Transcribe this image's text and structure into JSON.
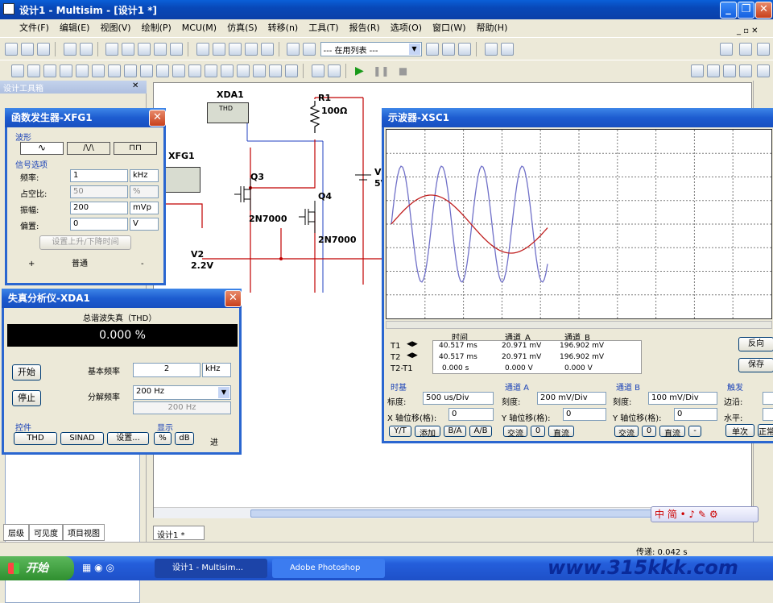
{
  "app": {
    "title": "设计1 - Multisim - [设计1 *]",
    "menu": [
      "文件(F)",
      "编辑(E)",
      "视图(V)",
      "绘制(P)",
      "MCU(M)",
      "仿真(S)",
      "转移(n)",
      "工具(T)",
      "报告(R)",
      "选项(O)",
      "窗口(W)",
      "帮助(H)"
    ],
    "in_use_list": "--- 在用列表 ---"
  },
  "design_toolbox": {
    "title": "设计工具箱",
    "tabs": [
      "层级",
      "可见度",
      "项目视图"
    ]
  },
  "function_generator": {
    "title": "函数发生器-XFG1",
    "waveform_label": "波形",
    "signal_options_label": "信号选项",
    "rows": [
      {
        "label": "频率:",
        "value": "1",
        "unit": "kHz"
      },
      {
        "label": "占空比:",
        "value": "50",
        "unit": "%"
      },
      {
        "label": "振幅:",
        "value": "200",
        "unit": "mVp"
      },
      {
        "label": "偏置:",
        "value": "0",
        "unit": "V"
      }
    ],
    "rise_fall_button": "设置上升/下降时间",
    "plus": "+",
    "common": "普通",
    "minus": "-"
  },
  "distortion_analyzer": {
    "title": "失真分析仪-XDA1",
    "thd_label": "总谐波失真（THD）",
    "thd_value": "0.000 %",
    "start_button": "开始",
    "stop_button": "停止",
    "fundamental_label": "基本频率",
    "fundamental_value": "2",
    "fundamental_unit": "kHz",
    "resolution_label": "分解频率",
    "resolution_value": "200 Hz",
    "resolution_readout": "200 Hz",
    "controls_label": "控件",
    "display_label": "显示",
    "thd_button": "THD",
    "sinad_button": "SINAD",
    "settings_button": "设置...",
    "percent_button": "%",
    "db_button": "dB",
    "in_label": "进"
  },
  "schematic": {
    "xda1": "XDA1",
    "thd_box": "THD",
    "xfg1": "XFG1",
    "r1": "R1",
    "r1_value": "100Ω",
    "q3": "Q3",
    "q3_part": "2N7000",
    "q4": "Q4",
    "q4_part": "2N7000",
    "v2": "V2",
    "v2_value": "2.2V",
    "v1": "V",
    "v1_value": "5V",
    "tab_label": "设计1 *"
  },
  "oscilloscope": {
    "title": "示波器-XSC1",
    "readout_headers": [
      "时间",
      "通道_A",
      "通道_B"
    ],
    "readout_rows": [
      {
        "label": "T1",
        "time": "40.517 ms",
        "a": "20.971 mV",
        "b": "196.902 mV"
      },
      {
        "label": "T2",
        "time": "40.517 ms",
        "a": "20.971 mV",
        "b": "196.902 mV"
      },
      {
        "label": "T2-T1",
        "time": "0.000 s",
        "a": "0.000 V",
        "b": "0.000 V"
      }
    ],
    "reverse_button": "反向",
    "save_button": "保存",
    "timebase": {
      "title": "时基",
      "scale_label": "标度:",
      "scale": "500 us/Div",
      "xpos_label": "X 轴位移(格):",
      "xpos": "0",
      "buttons": [
        "Y/T",
        "添加",
        "B/A",
        "A/B"
      ]
    },
    "channel_a": {
      "title": "通道 A",
      "scale_label": "刻度:",
      "scale": "200 mV/Div",
      "ypos_label": "Y 轴位移(格):",
      "ypos": "0",
      "buttons": [
        "交流",
        "0",
        "直流"
      ]
    },
    "channel_b": {
      "title": "通道 B",
      "scale_label": "刻度:",
      "scale": "100 mV/Div",
      "ypos_label": "Y 轴位移(格):",
      "ypos": "0",
      "buttons": [
        "交流",
        "0",
        "直流",
        "-"
      ]
    },
    "trigger": {
      "title": "触发",
      "edge_label": "边沿:",
      "level_label": "水平:",
      "buttons": [
        "单次",
        "正常"
      ]
    },
    "colors": {
      "channel_a": "#c02020",
      "channel_b": "#7070c8"
    }
  },
  "status": {
    "transfer": "传递: 0.042 s"
  },
  "taskbar": {
    "start": "开始",
    "items": [
      "设计1 - Multisim...",
      "Adobe Photoshop"
    ],
    "watermark": "www.315kkk.com"
  }
}
